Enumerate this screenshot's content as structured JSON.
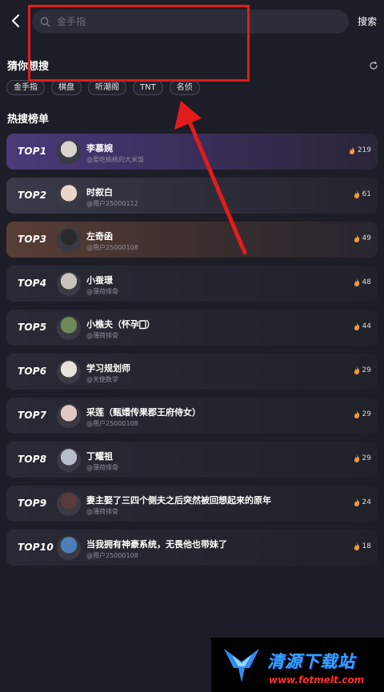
{
  "search": {
    "placeholder": "金手指",
    "button_label": "搜索"
  },
  "guess": {
    "title": "猜你想搜",
    "tags": [
      "金手指",
      "棋盘",
      "听潮阁",
      "TNT",
      "名侦"
    ]
  },
  "hot": {
    "title": "热搜榜单",
    "items": [
      {
        "rank": "TOP1",
        "name": "李慕婉",
        "author": "@爱吃桃桃的大米饭",
        "heat": "219",
        "avatar_color": "#d9d3cf"
      },
      {
        "rank": "TOP2",
        "name": "时叙白",
        "author": "@用户25000112",
        "heat": "61",
        "avatar_color": "#e8d6cc"
      },
      {
        "rank": "TOP3",
        "name": "左奇函",
        "author": "@用户25000108",
        "heat": "49",
        "avatar_color": "#2a2a2a"
      },
      {
        "rank": "TOP4",
        "name": "小蚕璟",
        "author": "@薄荷排骨",
        "heat": "48",
        "avatar_color": "#c9c3bb"
      },
      {
        "rank": "TOP5",
        "name": "小樵夫（怀孕🀆）",
        "author": "@薄荷排骨",
        "heat": "44",
        "avatar_color": "#6f8a5a"
      },
      {
        "rank": "TOP6",
        "name": "学习规划师",
        "author": "@天使数学",
        "heat": "29",
        "avatar_color": "#e6e2dc"
      },
      {
        "rank": "TOP7",
        "name": "采莲（甄嬛传果郡王府侍女）",
        "author": "@用户25000108",
        "heat": "29",
        "avatar_color": "#e0c9c4"
      },
      {
        "rank": "TOP8",
        "name": "丁耀祖",
        "author": "@薄荷排骨",
        "heat": "29",
        "avatar_color": "#b7bec9"
      },
      {
        "rank": "TOP9",
        "name": "妻主娶了三四个侧夫之后突然被回想起来的原年",
        "author": "@薄荷排骨",
        "heat": "24",
        "avatar_color": "#5a3a3a"
      },
      {
        "rank": "TOP10",
        "name": "当我拥有神豪系统，无畏他也带妹了",
        "author": "@用户25000108",
        "heat": "18",
        "avatar_color": "#4e7fb8"
      }
    ]
  },
  "watermark": {
    "name": "清源下载站",
    "url": "www.fotmelt.com"
  },
  "colors": {
    "background": "#1d1d27",
    "highlight": "#e21b1b",
    "flame": "#f59a3c"
  }
}
